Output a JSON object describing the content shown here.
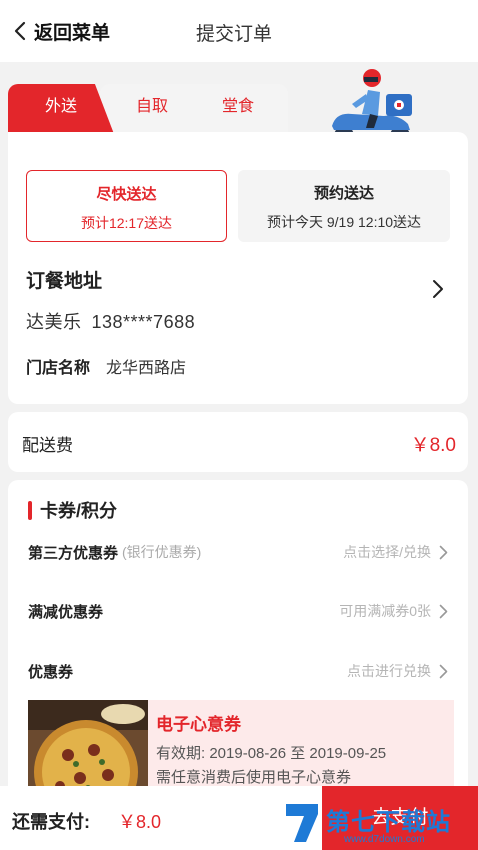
{
  "header": {
    "back_label": "返回菜单",
    "title": "提交订单"
  },
  "tabs": [
    {
      "label": "外送",
      "active": true
    },
    {
      "label": "自取",
      "active": false
    },
    {
      "label": "堂食",
      "active": false
    }
  ],
  "delivery_options": [
    {
      "title": "尽快送达",
      "subtitle": "预计12:17送达",
      "selected": true
    },
    {
      "title": "预约送达",
      "subtitle": "预计今天 9/19 12:10送达",
      "selected": false
    }
  ],
  "address": {
    "title": "订餐地址",
    "name": "达美乐",
    "phone": "138****7688",
    "store_label": "门店名称",
    "store_name": "龙华西路店"
  },
  "fee": {
    "label": "配送费",
    "value": "￥8.0"
  },
  "coupons": {
    "title": "卡券/积分",
    "rows": [
      {
        "label": "第三方优惠券",
        "sublabel": "(银行优惠券)",
        "action": "点击选择/兑换"
      },
      {
        "label": "满减优惠券",
        "sublabel": "",
        "action": "可用满减券0张"
      },
      {
        "label": "优惠券",
        "sublabel": "",
        "action": "点击进行兑换"
      }
    ],
    "ecard": {
      "title": "电子心意券",
      "validity": "有效期: 2019-08-26 至 2019-09-25",
      "desc": "需任意消费后使用电子心意券"
    }
  },
  "footer": {
    "pay_label": "还需支付:",
    "pay_value": "￥8.0",
    "button_label": "去支付"
  },
  "watermark": {
    "text": "第七下载站",
    "url": "www.d7down.com"
  },
  "colors": {
    "accent": "#e3262b",
    "background": "#f2f2f2"
  },
  "icons": [
    "chevron-left-icon",
    "chevron-right-icon",
    "scooter-rider-illustration",
    "pizza-image"
  ]
}
